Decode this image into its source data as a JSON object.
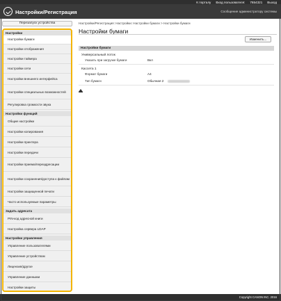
{
  "topbar": {
    "portal_link": "К порталу",
    "login_user": "Вход пользователя:",
    "user_id": "7654321",
    "logout": "Выход"
  },
  "header": {
    "title": "Настройки/Регистрация",
    "admin_message": "Сообщение администратору системы"
  },
  "sidebar": {
    "restart_label": "Перезапуск устройства",
    "sections": [
      {
        "title": "Настройки",
        "items": [
          "Настройки бумаги",
          "Настройки отображения",
          "Настройки таймера",
          "Настройки сети",
          "Настройки внешнего интерфейса",
          "Настройки специальных возможностей",
          "Регулировка громкости звука"
        ]
      },
      {
        "title": "Настройки функций",
        "items": [
          "Общие настройки",
          "Настройки копирования",
          "Настройки принтера",
          "Настройки передачи",
          "Настройки приема/переадресации",
          "Настройки сохранения/доступа к файлам",
          "Настройки защищенной печати",
          "Часто используемые параметры"
        ]
      },
      {
        "title": "Задать адресата",
        "items": [
          "PIN-код адресной книги",
          "Настройка сервера LDAP"
        ]
      },
      {
        "title": "Настройки управления",
        "items": [
          "Управление пользователями",
          "Управление устройством",
          "Лицензия/другое",
          "Управление данными",
          "Настройки защиты"
        ]
      }
    ],
    "selected": "Настройки бумаги"
  },
  "main": {
    "breadcrumb": "Настройки/Регистрация: Настройки: Настройки бумаги > Настройки бумаги",
    "page_title": "Настройки бумаги",
    "edit_button": "Изменить...",
    "section_title": "Настройки бумаги",
    "mp_tray": "Универсальный лоток",
    "mp_label": "Указать при загрузке бумаги",
    "mp_value": "Вкл",
    "drawer": "Кассета 1",
    "size_label": "Формат бумаги",
    "size_value": "A4",
    "type_label": "Тип бумаги",
    "type_value": "Обычная 2"
  },
  "footer": {
    "copyright": "Copyright CANON INC. 2016"
  }
}
